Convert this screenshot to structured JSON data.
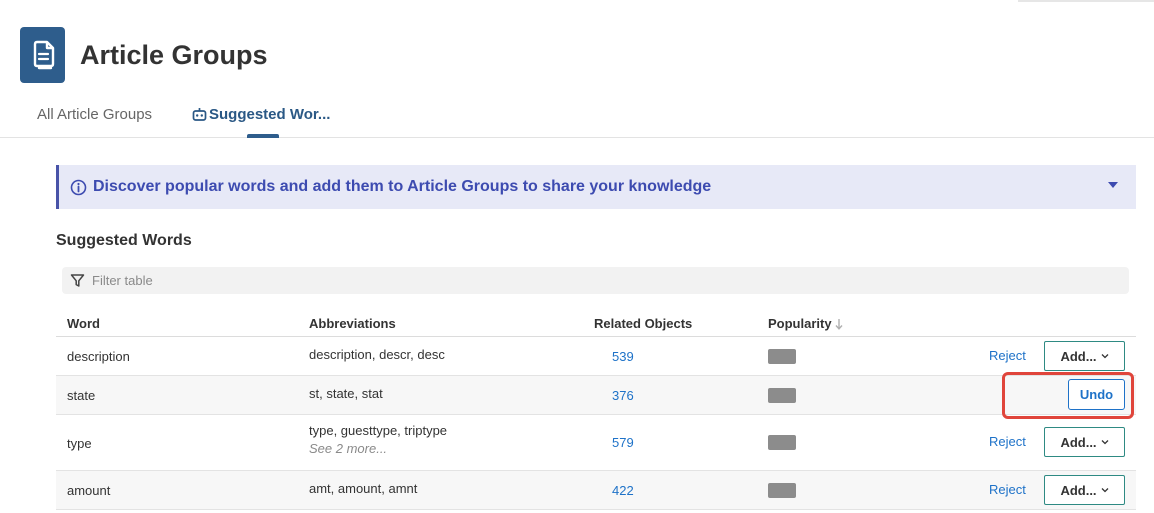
{
  "header": {
    "icon": "article-document-icon",
    "title": "Article Groups"
  },
  "tabs": [
    {
      "label": "All Article Groups",
      "active": false
    },
    {
      "label": "Suggested Wor...",
      "active": true,
      "icon": "robot-icon"
    }
  ],
  "banner": {
    "icon": "info-icon",
    "text": "Discover popular words and add them to Article Groups to share your knowledge",
    "color": "#3d4bb0",
    "background": "#e7e9f7"
  },
  "section_title": "Suggested Words",
  "filter": {
    "icon": "filter-icon",
    "placeholder": "Filter table",
    "value": ""
  },
  "table": {
    "columns": [
      "Word",
      "Abbreviations",
      "Related Objects",
      "Popularity"
    ],
    "sort": {
      "column": "Popularity",
      "direction": "descending"
    },
    "rows": [
      {
        "word": "description",
        "abbreviations": "description, descr, desc",
        "more": "",
        "related": "539",
        "action": "add",
        "reject_label": "Reject",
        "add_label": "Add..."
      },
      {
        "word": "state",
        "abbreviations": "st, state, stat",
        "more": "",
        "related": "376",
        "action": "undo",
        "undo_label": "Undo"
      },
      {
        "word": "type",
        "abbreviations": "type, guesttype, triptype",
        "more": "See 2 more...",
        "related": "579",
        "action": "add",
        "reject_label": "Reject",
        "add_label": "Add..."
      },
      {
        "word": "amount",
        "abbreviations": "amt, amount, amnt",
        "more": "",
        "related": "422",
        "action": "add",
        "reject_label": "Reject",
        "add_label": "Add..."
      }
    ]
  },
  "colors": {
    "brand": "#2e5d8c",
    "link": "#1e72c8",
    "highlight": "#e0453b",
    "add_border": "#2e8a83"
  }
}
